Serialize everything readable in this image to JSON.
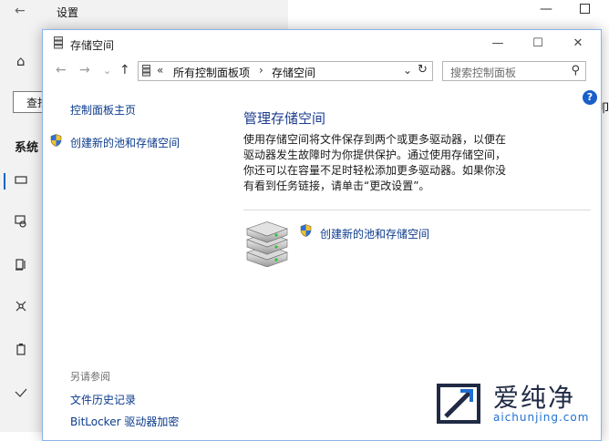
{
  "settings": {
    "back_glyph": "←",
    "title": "设置",
    "minimize_glyph": "—",
    "home_glyph": "⌂",
    "find_label": "查找",
    "system_label": "系统",
    "right_fragment": "叩"
  },
  "window": {
    "title": "存储空间",
    "minimize": "—",
    "maximize": "☐",
    "close": "✕"
  },
  "nav": {
    "back": "←",
    "forward": "→",
    "dropdown": "⌄",
    "up": "↑"
  },
  "address": {
    "chevron": "«",
    "crumbs": [
      "所有控制面板项",
      "存储空间"
    ],
    "separator": "›",
    "dropdown": "⌄",
    "refresh": "↻"
  },
  "search": {
    "placeholder": "搜索控制面板",
    "icon": "⚲"
  },
  "help_glyph": "?",
  "left_panel": {
    "home_link": "控制面板主页",
    "create_link": "创建新的池和存储空间",
    "see_also": "另请参阅",
    "links": [
      "文件历史记录",
      "BitLocker 驱动器加密"
    ]
  },
  "main": {
    "title": "管理存储空间",
    "description_lines": [
      "使用存储空间将文件保存到两个或更多驱动器，以便在",
      "驱动器发生故障时为你提供保护。通过使用存储空间，",
      "你还可以在容量不足时轻松添加更多驱动器。如果你没",
      "有看到任务链接，请单击“更改设置”。"
    ],
    "create_link": "创建新的池和存储空间"
  },
  "watermark": {
    "text": "爱纯净",
    "url": "aichunjing.com"
  },
  "colors": {
    "link": "#0b3b8c",
    "title": "#1e3d8f",
    "accent": "#0067c0",
    "window_border": "#8ab4e8"
  }
}
